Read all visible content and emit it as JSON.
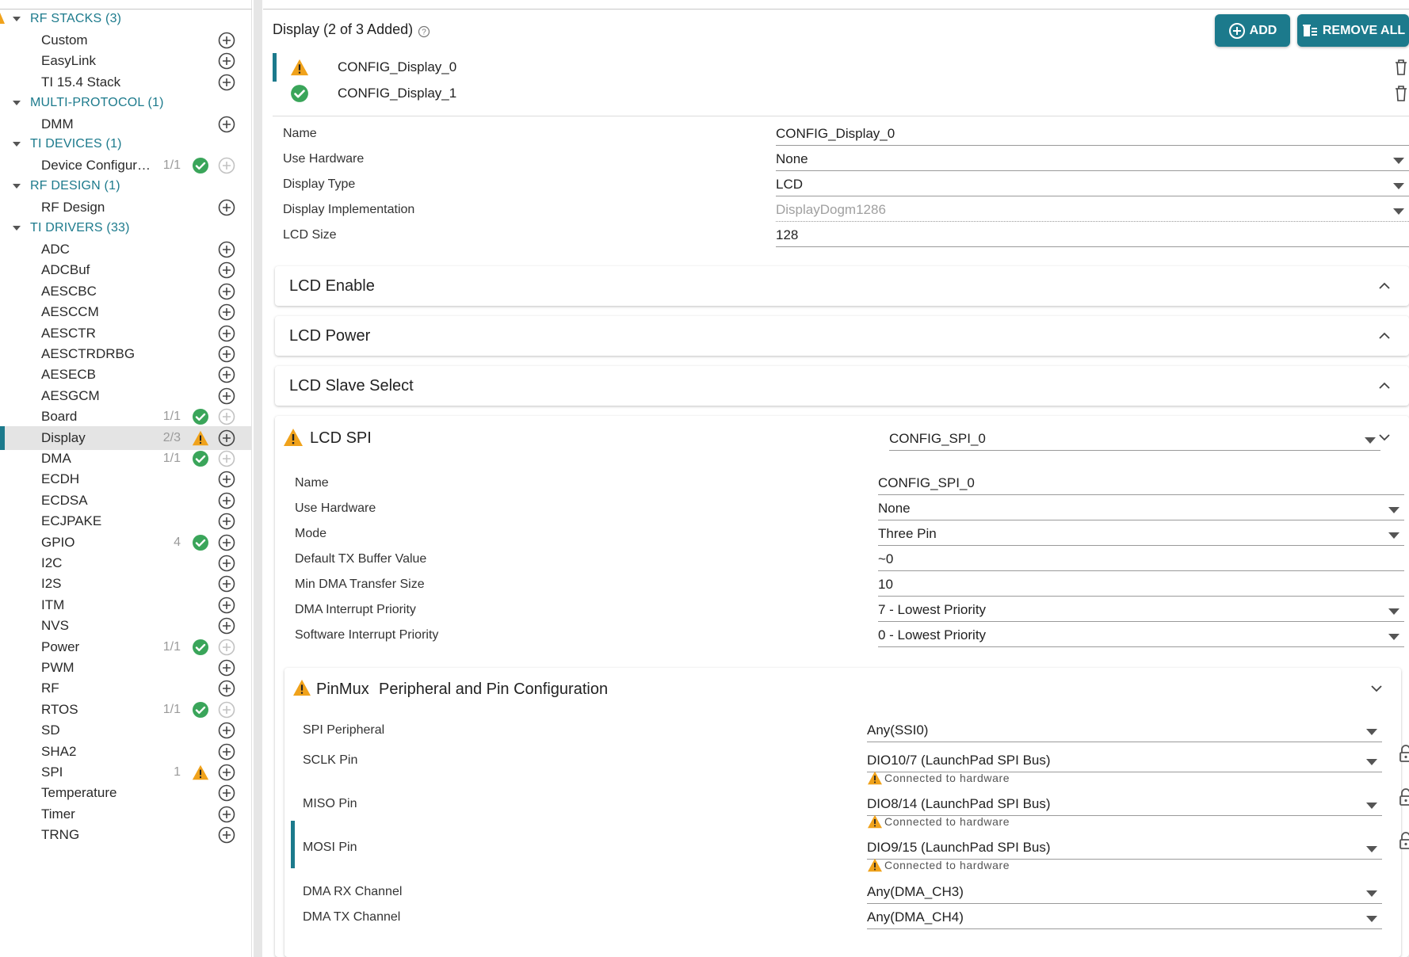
{
  "sidebar": {
    "categories": [
      {
        "label": "RF STACKS (3)",
        "items": [
          {
            "label": "Custom",
            "count": "",
            "status": "",
            "add_enabled": true
          },
          {
            "label": "EasyLink",
            "count": "",
            "status": "",
            "add_enabled": true
          },
          {
            "label": "TI 15.4 Stack",
            "count": "",
            "status": "",
            "add_enabled": true
          }
        ]
      },
      {
        "label": "MULTI-PROTOCOL (1)",
        "items": [
          {
            "label": "DMM",
            "count": "",
            "status": "",
            "add_enabled": true
          }
        ]
      },
      {
        "label": "TI DEVICES (1)",
        "items": [
          {
            "label": "Device Configur…",
            "count": "1/1",
            "status": "ok",
            "add_enabled": false
          }
        ]
      },
      {
        "label": "RF DESIGN (1)",
        "items": [
          {
            "label": "RF Design",
            "count": "",
            "status": "",
            "add_enabled": true
          }
        ]
      },
      {
        "label": "TI DRIVERS (33)",
        "items": [
          {
            "label": "ADC",
            "count": "",
            "status": "",
            "add_enabled": true
          },
          {
            "label": "ADCBuf",
            "count": "",
            "status": "",
            "add_enabled": true
          },
          {
            "label": "AESCBC",
            "count": "",
            "status": "",
            "add_enabled": true
          },
          {
            "label": "AESCCM",
            "count": "",
            "status": "",
            "add_enabled": true
          },
          {
            "label": "AESCTR",
            "count": "",
            "status": "",
            "add_enabled": true
          },
          {
            "label": "AESCTRDRBG",
            "count": "",
            "status": "",
            "add_enabled": true
          },
          {
            "label": "AESECB",
            "count": "",
            "status": "",
            "add_enabled": true
          },
          {
            "label": "AESGCM",
            "count": "",
            "status": "",
            "add_enabled": true
          },
          {
            "label": "Board",
            "count": "1/1",
            "status": "ok",
            "add_enabled": false
          },
          {
            "label": "Display",
            "count": "2/3",
            "status": "warn",
            "add_enabled": true,
            "active": true
          },
          {
            "label": "DMA",
            "count": "1/1",
            "status": "ok",
            "add_enabled": false
          },
          {
            "label": "ECDH",
            "count": "",
            "status": "",
            "add_enabled": true
          },
          {
            "label": "ECDSA",
            "count": "",
            "status": "",
            "add_enabled": true
          },
          {
            "label": "ECJPAKE",
            "count": "",
            "status": "",
            "add_enabled": true
          },
          {
            "label": "GPIO",
            "count": "4",
            "status": "ok",
            "add_enabled": true
          },
          {
            "label": "I2C",
            "count": "",
            "status": "",
            "add_enabled": true
          },
          {
            "label": "I2S",
            "count": "",
            "status": "",
            "add_enabled": true
          },
          {
            "label": "ITM",
            "count": "",
            "status": "",
            "add_enabled": true
          },
          {
            "label": "NVS",
            "count": "",
            "status": "",
            "add_enabled": true
          },
          {
            "label": "Power",
            "count": "1/1",
            "status": "ok",
            "add_enabled": false
          },
          {
            "label": "PWM",
            "count": "",
            "status": "",
            "add_enabled": true
          },
          {
            "label": "RF",
            "count": "",
            "status": "",
            "add_enabled": true
          },
          {
            "label": "RTOS",
            "count": "1/1",
            "status": "ok",
            "add_enabled": false
          },
          {
            "label": "SD",
            "count": "",
            "status": "",
            "add_enabled": true
          },
          {
            "label": "SHA2",
            "count": "",
            "status": "",
            "add_enabled": true
          },
          {
            "label": "SPI",
            "count": "1",
            "status": "warn",
            "add_enabled": true
          },
          {
            "label": "Temperature",
            "count": "",
            "status": "",
            "add_enabled": true
          },
          {
            "label": "Timer",
            "count": "",
            "status": "",
            "add_enabled": true
          },
          {
            "label": "TRNG",
            "count": "",
            "status": "",
            "add_enabled": true
          }
        ]
      }
    ]
  },
  "main": {
    "title": "Display (2 of 3 Added)",
    "add_label": "ADD",
    "remove_all_label": "REMOVE ALL",
    "instances": [
      {
        "label": "CONFIG_Display_0",
        "status": "warn",
        "selected": true
      },
      {
        "label": "CONFIG_Display_1",
        "status": "ok",
        "selected": false
      }
    ],
    "fields": {
      "name": {
        "label": "Name",
        "value": "CONFIG_Display_0"
      },
      "use_hardware": {
        "label": "Use Hardware",
        "value": "None"
      },
      "display_type": {
        "label": "Display Type",
        "value": "LCD"
      },
      "display_impl": {
        "label": "Display Implementation",
        "value": "DisplayDogm1286"
      },
      "lcd_size": {
        "label": "LCD Size",
        "value": "128"
      }
    },
    "panels": {
      "lcd_enable": "LCD Enable",
      "lcd_power": "LCD Power",
      "lcd_slave_select": "LCD Slave Select"
    },
    "lcd_spi": {
      "title": "LCD SPI",
      "selected": "CONFIG_SPI_0",
      "fields": {
        "name": {
          "label": "Name",
          "value": "CONFIG_SPI_0"
        },
        "use_hardware": {
          "label": "Use Hardware",
          "value": "None"
        },
        "mode": {
          "label": "Mode",
          "value": "Three Pin"
        },
        "default_tx": {
          "label": "Default TX Buffer Value",
          "value": "~0"
        },
        "min_dma": {
          "label": "Min DMA Transfer Size",
          "value": "10"
        },
        "dma_int_pri": {
          "label": "DMA Interrupt Priority",
          "value": "7 - Lowest Priority"
        },
        "sw_int_pri": {
          "label": "Software Interrupt Priority",
          "value": "0 - Lowest Priority"
        }
      }
    },
    "pinmux": {
      "title": "PinMux",
      "subtitle": "Peripheral and Pin Configuration",
      "hw_note": "Connected to hardware",
      "fields": {
        "spi_peripheral": {
          "label": "SPI Peripheral",
          "value": "Any(SSI0)"
        },
        "sclk": {
          "label": "SCLK Pin",
          "value": "DIO10/7 (LaunchPad SPI Bus)"
        },
        "miso": {
          "label": "MISO Pin",
          "value": "DIO8/14 (LaunchPad SPI Bus)"
        },
        "mosi": {
          "label": "MOSI Pin",
          "value": "DIO9/15 (LaunchPad SPI Bus)"
        },
        "dma_rx": {
          "label": "DMA RX Channel",
          "value": "Any(DMA_CH3)"
        },
        "dma_tx": {
          "label": "DMA TX Channel",
          "value": "Any(DMA_CH4)"
        }
      }
    }
  },
  "colors": {
    "accent": "#1c7a8c",
    "ok": "#3aa55a",
    "warn": "#f0a21b"
  }
}
